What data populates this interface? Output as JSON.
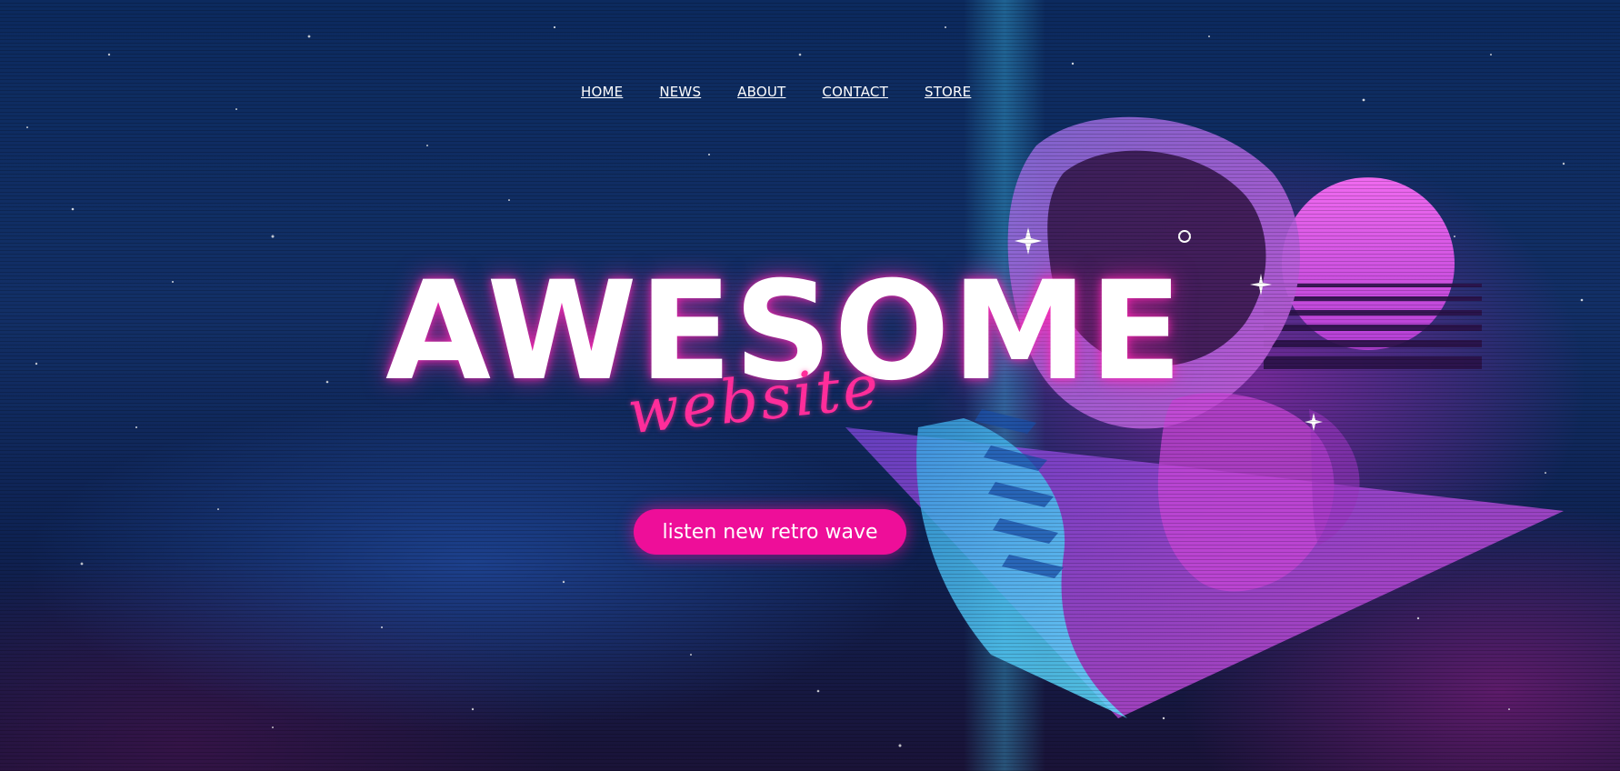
{
  "nav": {
    "items": [
      {
        "label": "HOME"
      },
      {
        "label": "NEWS"
      },
      {
        "label": "ABOUT"
      },
      {
        "label": "CONTACT"
      },
      {
        "label": "STORE"
      }
    ]
  },
  "hero": {
    "title": "AWESOME",
    "subtitle": "website",
    "cta_label": "listen new retro wave"
  },
  "colors": {
    "accent": "#ee0e99",
    "subtitle": "#ff2d9a",
    "background": "#0c2a5e",
    "sun": "#e04ee0",
    "glow_cyan": "#47d6ff"
  },
  "icons": {
    "artwork": "astronaut-illustration",
    "sun": "retro-sun",
    "triangle": "neon-triangle"
  }
}
